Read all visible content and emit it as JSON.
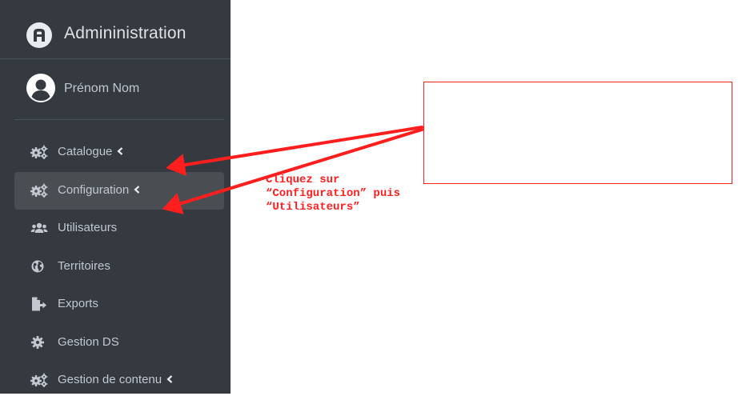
{
  "sidebar": {
    "brand": "Admininistration",
    "user_name": "Prénom Nom",
    "items": [
      {
        "label": "Catalogue",
        "icon": "gears-icon",
        "has_caret": true,
        "active": false
      },
      {
        "label": "Configuration",
        "icon": "gears-icon",
        "has_caret": true,
        "active": true
      },
      {
        "label": "Utilisateurs",
        "icon": "users-icon",
        "has_caret": false,
        "active": false
      },
      {
        "label": "Territoires",
        "icon": "globe-icon",
        "has_caret": false,
        "active": false
      },
      {
        "label": "Exports",
        "icon": "file-export-icon",
        "has_caret": false,
        "active": false
      },
      {
        "label": "Gestion DS",
        "icon": "gear-icon",
        "has_caret": false,
        "active": false
      },
      {
        "label": "Gestion de contenu",
        "icon": "gears-icon",
        "has_caret": true,
        "active": false
      }
    ]
  },
  "annotation": {
    "line1": "Cliquez sur",
    "line2": "“Configuration” puis",
    "line3": "“Utilisateurs”",
    "color": "#ff1e1e"
  },
  "colors": {
    "sidebar_bg": "#343a40",
    "active_item_bg": "#494e53",
    "text": "#c2c7d0"
  }
}
